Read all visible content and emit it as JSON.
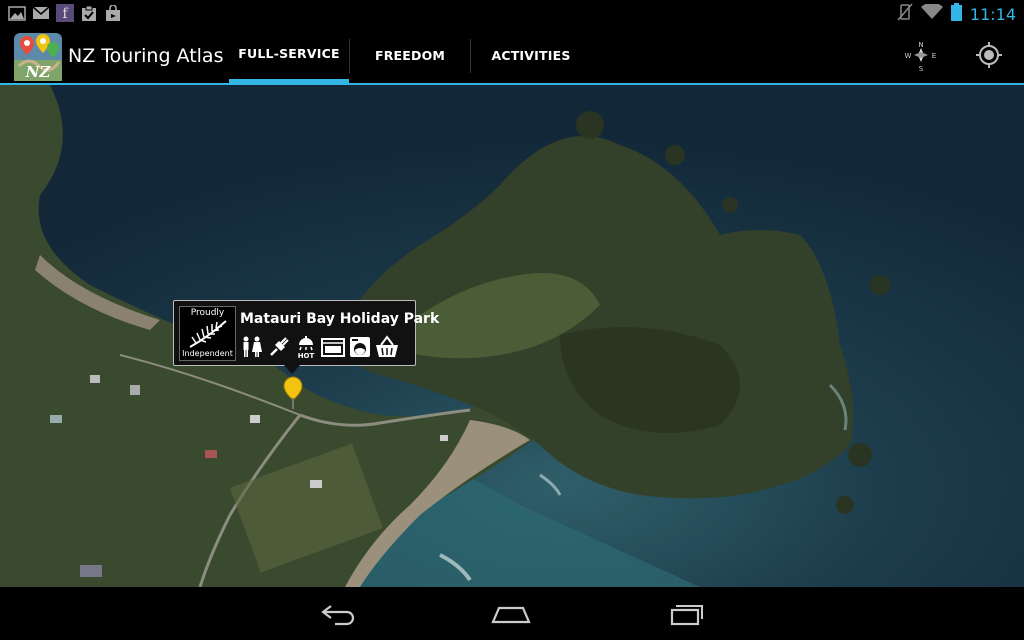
{
  "status_bar": {
    "time": "11:14",
    "left_icons": [
      "gallery-icon",
      "mail-icon",
      "app-notification-icon",
      "clipboard-check-icon",
      "shopping-bag-icon"
    ],
    "right_icons": [
      "vibrate-mute-icon",
      "wifi-icon",
      "battery-icon"
    ],
    "accent_color": "#33b5e5"
  },
  "action_bar": {
    "app_title": "NZ Touring Atlas",
    "tabs": [
      {
        "label": "FULL-SERVICE",
        "selected": true
      },
      {
        "label": "FREEDOM",
        "selected": false
      },
      {
        "label": "ACTIVITIES",
        "selected": false
      }
    ],
    "actions": [
      "compass-icon",
      "my-location-icon"
    ]
  },
  "map": {
    "type": "satellite",
    "callout": {
      "badge_top": "Proudly",
      "badge_bottom": "Independent",
      "name": "Matauri Bay Holiday Park",
      "amenities": [
        "toilets-icon",
        "power-icon",
        "hot-shower-icon",
        "kitchen-icon",
        "laundry-icon",
        "shop-icon"
      ]
    },
    "pin_color": "#f2c40f"
  },
  "nav_bar": {
    "buttons": [
      "back-icon",
      "home-icon",
      "recent-apps-icon"
    ]
  }
}
